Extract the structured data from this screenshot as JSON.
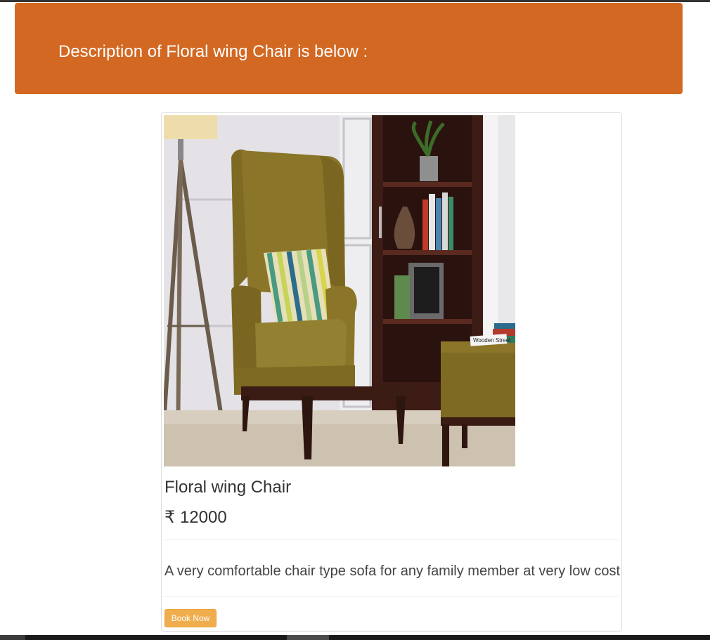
{
  "banner": {
    "title": "Description of Floral wing Chair is below :",
    "color": "#d26822"
  },
  "product": {
    "image_alt": "Floral wing Chair",
    "name": "Floral wing Chair",
    "price": "₹ 12000",
    "description": "A very comfortable chair type sofa for any family member at very low cost",
    "book_label": "Book Now",
    "accent_color": "#f0ad4e"
  },
  "image_text": {
    "book_label": "Wooden Street"
  }
}
